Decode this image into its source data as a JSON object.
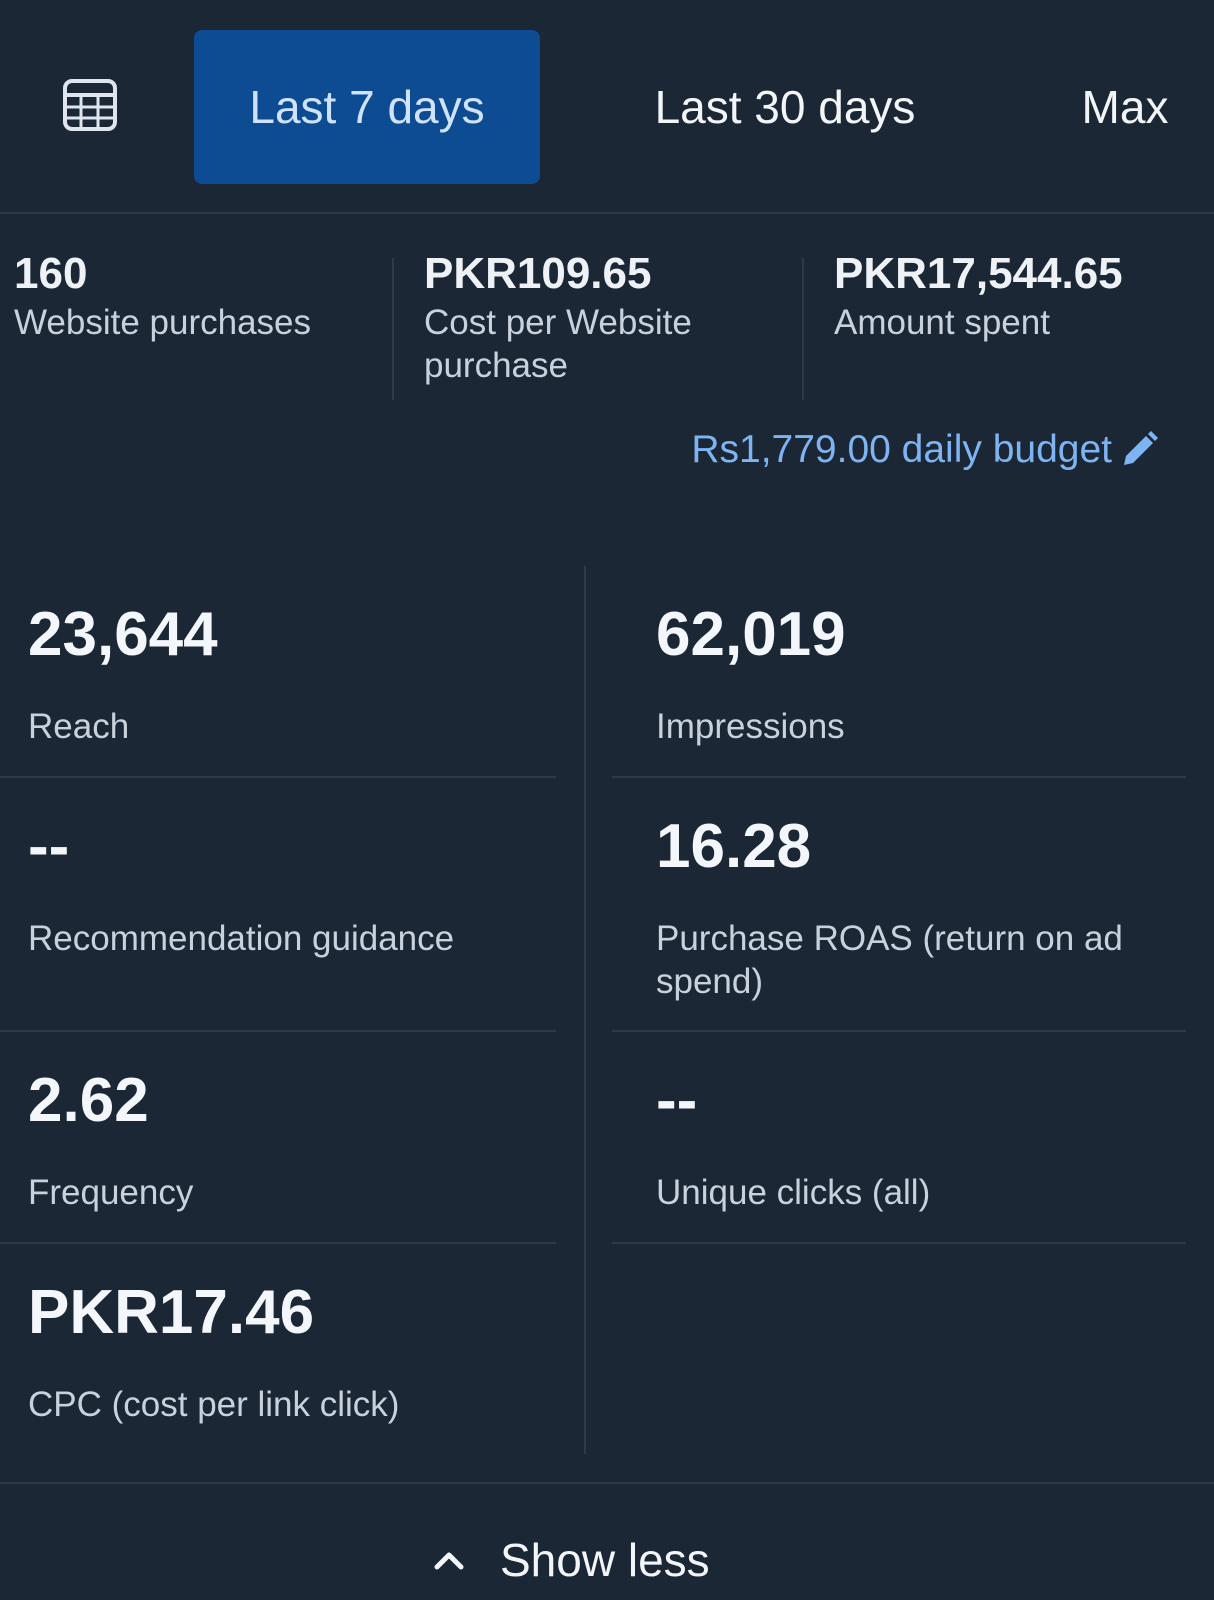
{
  "range_tabs": {
    "calendar_icon": "calendar-icon",
    "items": [
      {
        "label": "Last 7 days",
        "active": true
      },
      {
        "label": "Last 30 days",
        "active": false
      },
      {
        "label": "Max",
        "active": false
      }
    ],
    "active_color": "#0d4b93"
  },
  "summary": [
    {
      "value": "160",
      "label": "Website purchases"
    },
    {
      "value": "PKR109.65",
      "label": "Cost per Website purchase"
    },
    {
      "value": "PKR17,544.65",
      "label": "Amount spent"
    }
  ],
  "budget": {
    "label": "Rs1,779.00 daily budget",
    "icon": "pencil-icon",
    "color": "#7eb4f2"
  },
  "metrics": [
    {
      "value": "23,644",
      "label": "Reach"
    },
    {
      "value": "62,019",
      "label": "Impressions"
    },
    {
      "value": "--",
      "label": "Recommendation guidance"
    },
    {
      "value": "16.28",
      "label": "Purchase ROAS (return on ad spend)"
    },
    {
      "value": "2.62",
      "label": "Frequency"
    },
    {
      "value": "--",
      "label": "Unique clicks (all)"
    },
    {
      "value": "PKR17.46",
      "label": "CPC (cost per link click)"
    }
  ],
  "footer": {
    "show_less_label": "Show less",
    "icon": "chevron-up-icon"
  },
  "colors": {
    "background": "#1c2735",
    "divider": "#2c3a4b"
  }
}
